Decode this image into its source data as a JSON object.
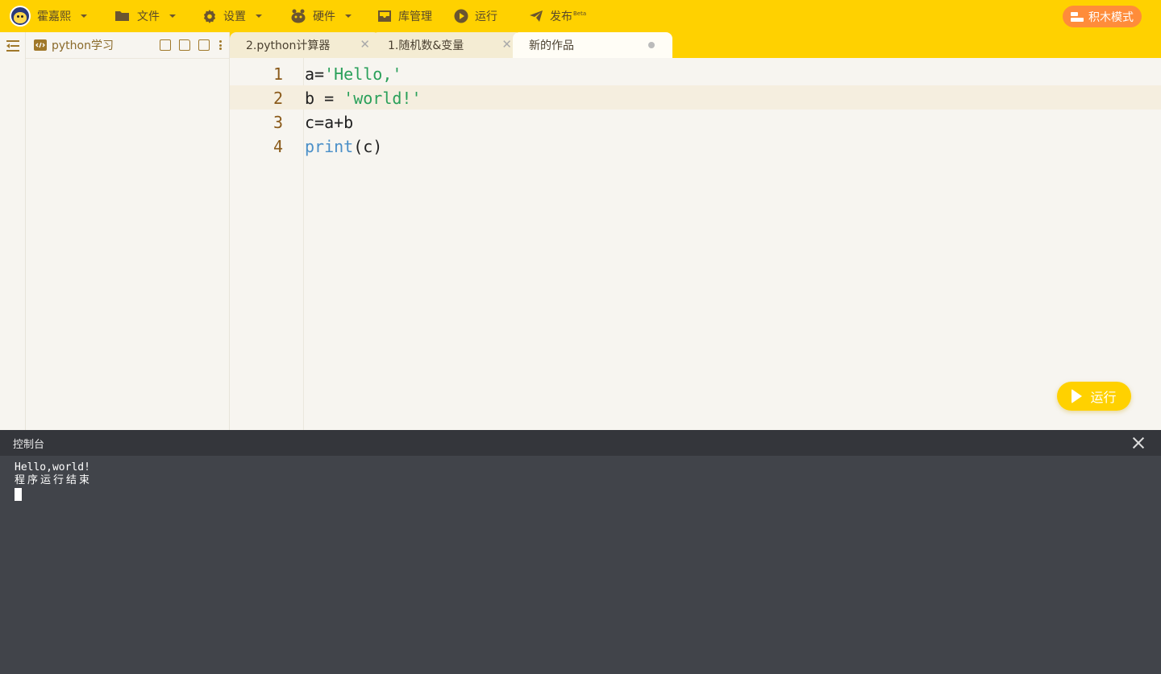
{
  "topbar": {
    "user_name": "霍嘉熙",
    "file_label": "文件",
    "settings_label": "设置",
    "hardware_label": "硬件",
    "library_label": "库管理",
    "run_label": "运行",
    "publish_label": "发布",
    "publish_badge": "Beta",
    "block_mode_label": "积木模式"
  },
  "sidebar": {
    "project_name": "python学习"
  },
  "tabs": [
    {
      "label": "2.python计算器",
      "active": false
    },
    {
      "label": "1.随机数&变量",
      "active": false
    },
    {
      "label": "新的作品",
      "active": true,
      "unsaved": true
    }
  ],
  "editor": {
    "lines": [
      {
        "number": "1",
        "parts": [
          {
            "t": "a=",
            "c": "plain"
          },
          {
            "t": "'Hello,'",
            "c": "str"
          }
        ]
      },
      {
        "number": "2",
        "parts": [
          {
            "t": "b = ",
            "c": "plain"
          },
          {
            "t": "'world!'",
            "c": "str"
          }
        ]
      },
      {
        "number": "3",
        "parts": [
          {
            "t": "c=a+b",
            "c": "plain"
          }
        ]
      },
      {
        "number": "4",
        "parts": [
          {
            "t": "print",
            "c": "kw"
          },
          {
            "t": "(c)",
            "c": "plain"
          }
        ]
      }
    ],
    "current_line": 2,
    "run_button_label": "运行"
  },
  "console": {
    "title": "控制台",
    "output": [
      "Hello,world!",
      "程序运行结束"
    ]
  },
  "colors": {
    "topbar": "#ffd100",
    "block_mode": "#ff8c3a",
    "string": "#2aa05a",
    "keyword": "#4a8fc8",
    "console_bg": "#41444a"
  }
}
